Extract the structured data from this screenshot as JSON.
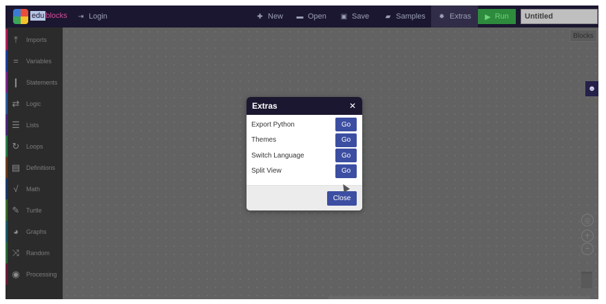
{
  "app": {
    "logo_parts": [
      "edu",
      "blocks"
    ],
    "login_label": "Login",
    "title_value": "Untitled"
  },
  "toolbar": {
    "new_label": "New",
    "open_label": "Open",
    "save_label": "Save",
    "samples_label": "Samples",
    "extras_label": "Extras",
    "run_label": "Run"
  },
  "sidebar": {
    "categories": [
      {
        "label": "Imports",
        "icon": "import-icon",
        "color": "#b01e5a"
      },
      {
        "label": "Variables",
        "icon": "equals-icon",
        "color": "#1e3f9a"
      },
      {
        "label": "Statements",
        "icon": "statement-icon",
        "color": "#7a2a8a"
      },
      {
        "label": "Logic",
        "icon": "swap-icon",
        "color": "#2f5a9a"
      },
      {
        "label": "Lists",
        "icon": "list-icon",
        "color": "#4a2a7a"
      },
      {
        "label": "Loops",
        "icon": "loop-icon",
        "color": "#2a7a4a"
      },
      {
        "label": "Definitions",
        "icon": "definitions-icon",
        "color": "#6a3a1a"
      },
      {
        "label": "Math",
        "icon": "sqrt-icon",
        "color": "#1a3a6a"
      },
      {
        "label": "Turtle",
        "icon": "pencil-icon",
        "color": "#3a6a2a"
      },
      {
        "label": "Graphs",
        "icon": "pie-icon",
        "color": "#1a5a6a"
      },
      {
        "label": "Random",
        "icon": "shuffle-icon",
        "color": "#2a6a3a"
      },
      {
        "label": "Processing",
        "icon": "palette-icon",
        "color": "#6a1a3a"
      }
    ]
  },
  "workspace": {
    "blocks_tab": "Blocks"
  },
  "modal": {
    "title": "Extras",
    "items": [
      {
        "label": "Export Python",
        "button": "Go"
      },
      {
        "label": "Themes",
        "button": "Go"
      },
      {
        "label": "Switch Language",
        "button": "Go"
      },
      {
        "label": "Split View",
        "button": "Go"
      }
    ],
    "close_label": "Close"
  },
  "colors": {
    "topbar": "#1b1730",
    "accent_button": "#3c4ea2",
    "run_green": "#2e8b3d"
  }
}
